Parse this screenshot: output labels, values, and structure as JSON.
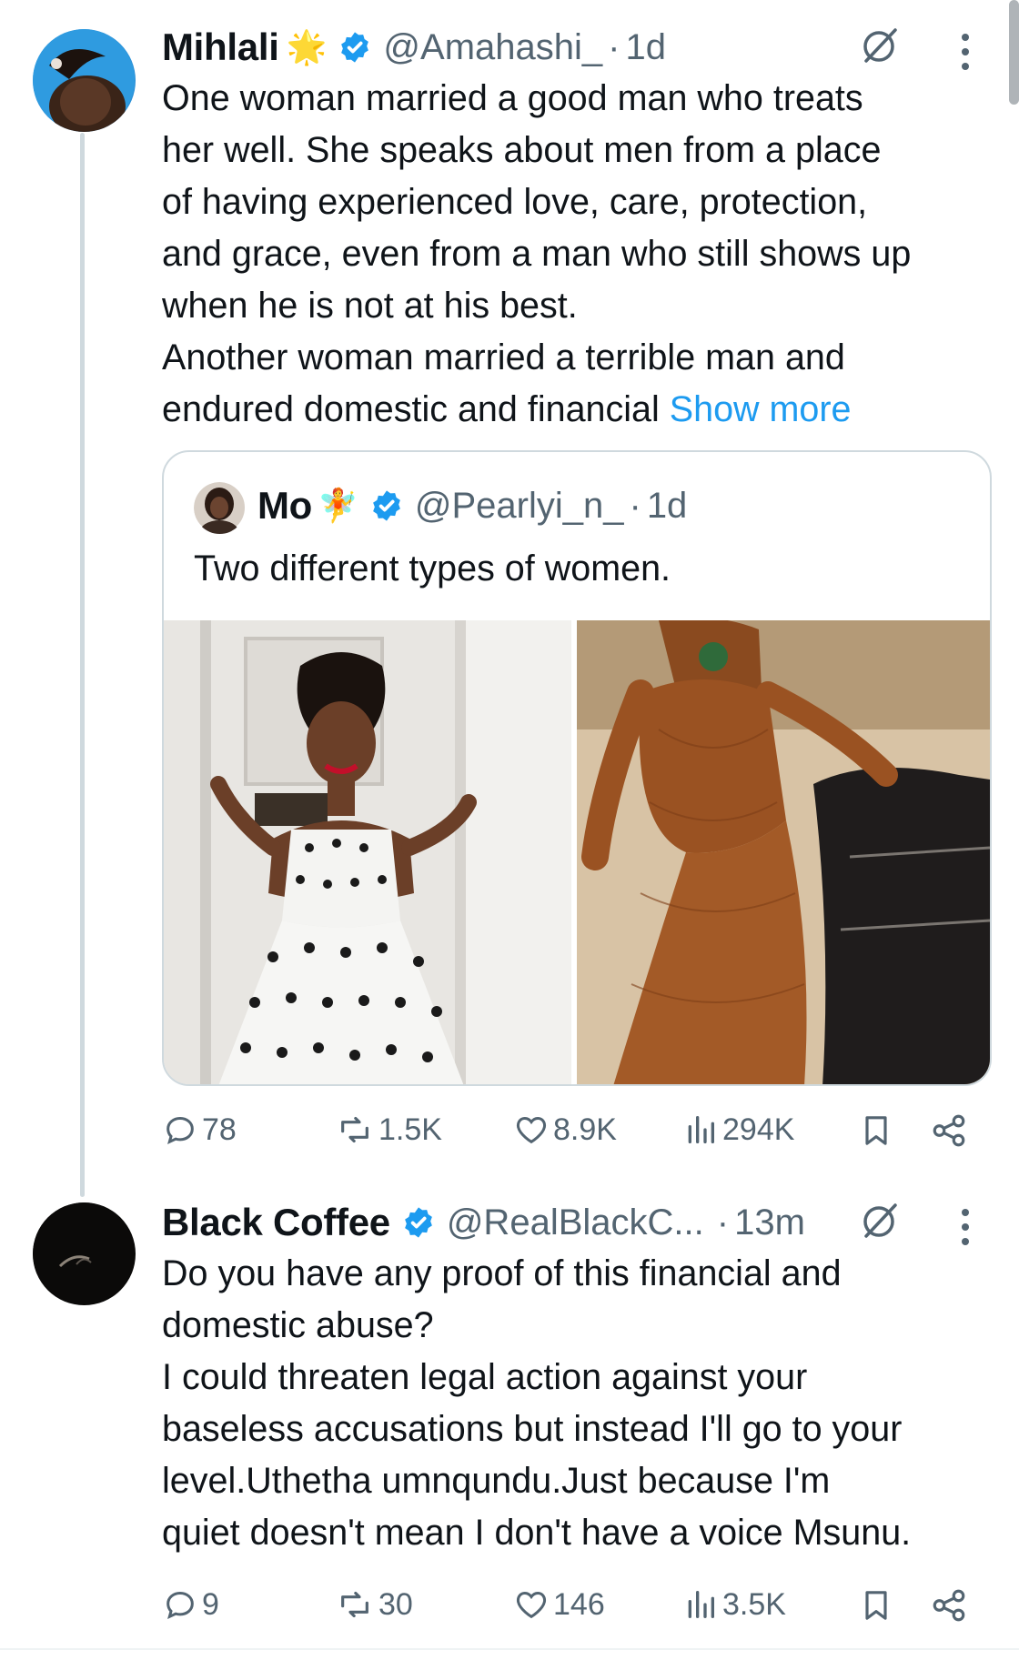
{
  "tweet1": {
    "name": "Mihlali",
    "name_emoji": "🌟",
    "handle": "@Amahashi_",
    "dot": "·",
    "time": "1d",
    "text": "One woman married a good man who treats\nher well. She speaks about men from a place\nof having experienced love, care, protection,\nand grace, even from a man who still shows up\nwhen he is not at his best.\nAnother woman married a terrible man and\nendured domestic and financial ",
    "show_more": "Show more",
    "quote": {
      "name": "Mo",
      "name_emoji": "🧚",
      "handle": "@Pearlyi_n_",
      "dot": "·",
      "time": "1d",
      "text": "Two different types of women.",
      "images": [
        "woman-in-polka-dot-dress-photo",
        "woman-in-brown-lace-gown-photo"
      ]
    },
    "actions": {
      "replies": "78",
      "reposts": "1.5K",
      "likes": "8.9K",
      "views": "294K"
    }
  },
  "tweet2": {
    "name": "Black Coffee",
    "handle": "@RealBlackC...",
    "dot": "·",
    "time": "13m",
    "text": "Do you have any proof of this financial and\ndomestic abuse?\nI could threaten legal action against your\nbaseless accusations but instead I'll go to your\nlevel.Uthetha umnqundu.Just because I'm\nquiet doesn't mean I don't have a voice Msunu.",
    "actions": {
      "replies": "9",
      "reposts": "30",
      "likes": "146",
      "views": "3.5K"
    }
  },
  "icons": {
    "verified": "verified-badge-icon",
    "grok": "grok-icon",
    "more": "more-options-icon",
    "reply": "reply-icon",
    "repost": "repost-icon",
    "like": "like-icon",
    "views": "views-icon",
    "bookmark": "bookmark-icon",
    "share": "share-icon"
  },
  "colors": {
    "link": "#1d9bf0",
    "verified": "#1d9bf0",
    "muted": "#536471",
    "text": "#0f1419"
  }
}
